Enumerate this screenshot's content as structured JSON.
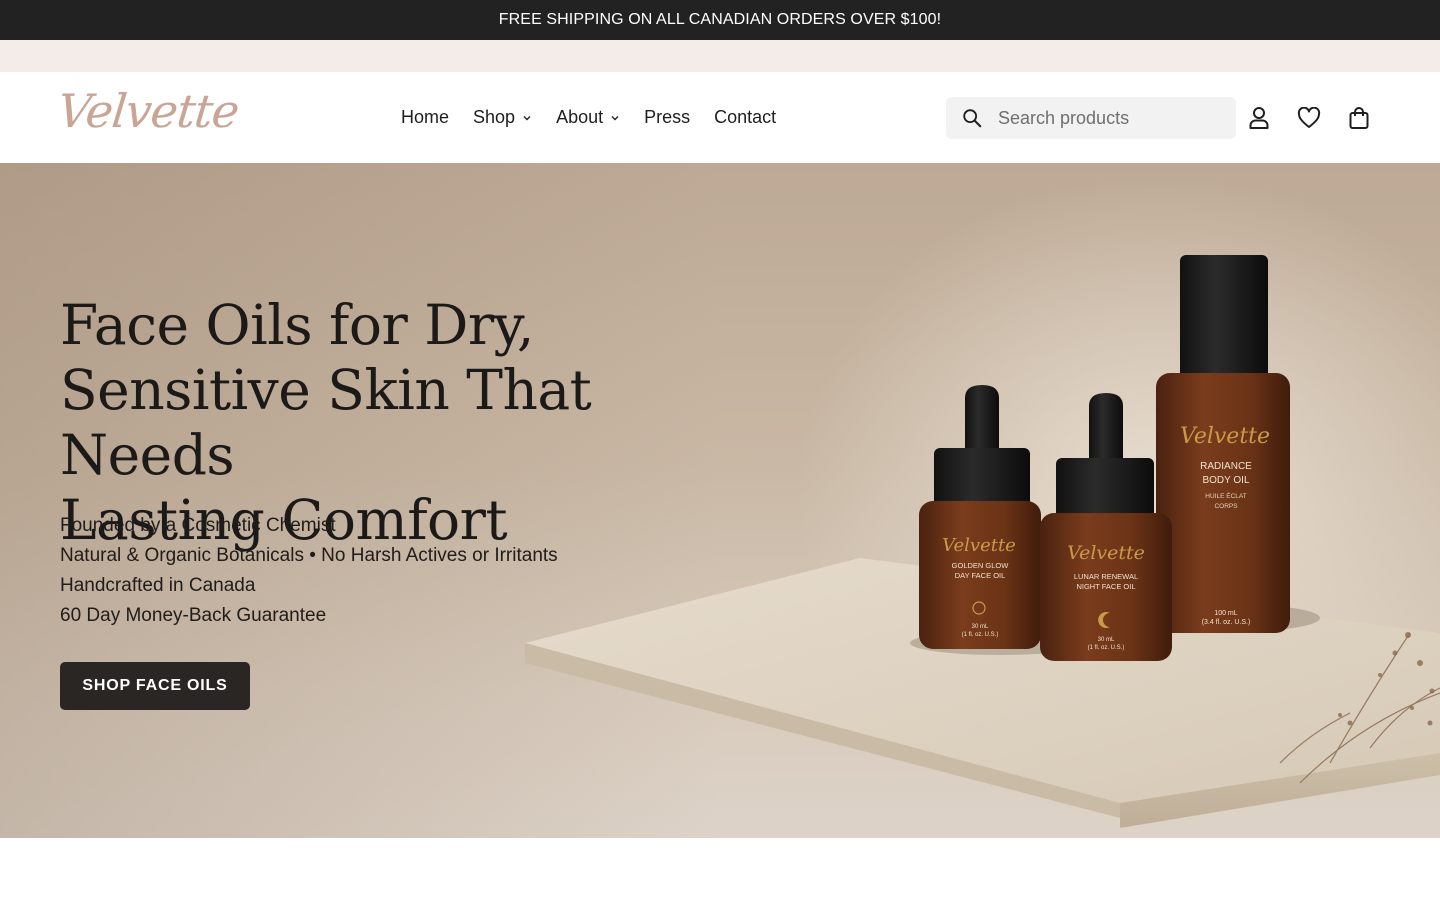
{
  "announcement": {
    "text": "FREE SHIPPING ON ALL CANADIAN ORDERS OVER $100!"
  },
  "brand": {
    "logo_text": "Velvette",
    "logo_color": "#c9a596"
  },
  "nav": {
    "items": [
      {
        "label": "Home",
        "has_dropdown": false
      },
      {
        "label": "Shop",
        "has_dropdown": true
      },
      {
        "label": "About",
        "has_dropdown": true
      },
      {
        "label": "Press",
        "has_dropdown": false
      },
      {
        "label": "Contact",
        "has_dropdown": false
      }
    ]
  },
  "search": {
    "placeholder": "Search products",
    "value": ""
  },
  "header_icons": [
    "account-icon",
    "wishlist-heart-icon",
    "cart-bag-icon"
  ],
  "hero": {
    "title_lines": [
      "Face Oils for Dry,",
      "Sensitive Skin That Needs",
      "Lasting Comfort"
    ],
    "points": [
      "Founded by a Cosmetic Chemist",
      "Natural & Organic Botanicals • No Harsh Actives or Irritants",
      "Handcrafted in Canada",
      "60 Day Money-Back Guarantee"
    ],
    "cta_label": "SHOP FACE OILS",
    "cta_color": "#2a2624"
  },
  "products": [
    {
      "brand": "Velvette",
      "name_line1": "GOLDEN GLOW",
      "name_line2": "DAY FACE OIL",
      "size_line1": "30 mL",
      "size_line2": "(1 fl. oz. U.S.)"
    },
    {
      "brand": "Velvette",
      "name_line1": "LUNAR RENEWAL",
      "name_line2": "NIGHT FACE OIL",
      "size_line1": "30 mL",
      "size_line2": "(1 fl. oz. U.S.)"
    },
    {
      "brand": "Velvette",
      "name_line1": "RADIANCE",
      "name_line2": "BODY OIL",
      "sub_line1": "HUILE ÉCLAT",
      "sub_line2": "CORPS",
      "size_line1": "100 mL",
      "size_line2": "(3.4 fl. oz. U.S.)"
    }
  ]
}
